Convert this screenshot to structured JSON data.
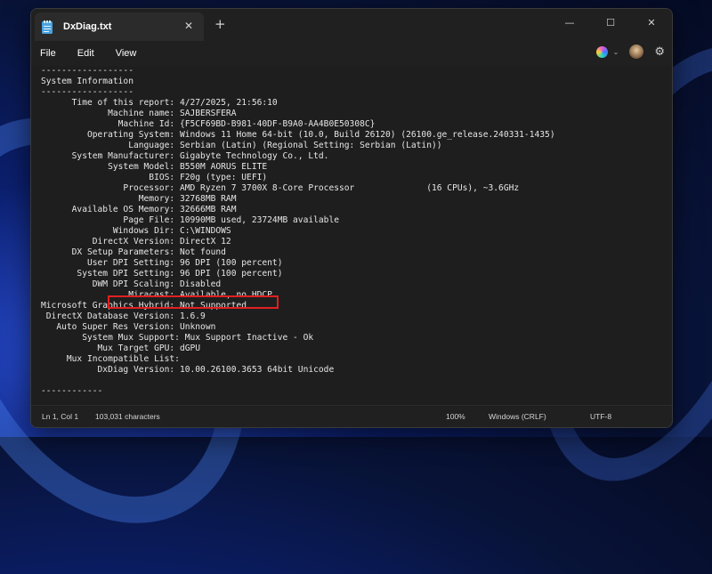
{
  "window": {
    "tab_title": "DxDiag.txt",
    "close_tab": "✕",
    "new_tab": "+",
    "minimize": "—",
    "maximize": "☐",
    "close": "✕"
  },
  "menu": {
    "file": "File",
    "edit": "Edit",
    "view": "View",
    "chevron": "⌄",
    "settings": "⚙"
  },
  "lines": [
    "------------------",
    "System Information",
    "------------------",
    "      Time of this report: 4/27/2025, 21:56:10",
    "             Machine name: SAJBERSFERA",
    "               Machine Id: {F5CF69BD-B981-40DF-B9A0-AA4B0E50308C}",
    "         Operating System: Windows 11 Home 64-bit (10.0, Build 26120) (26100.ge_release.240331-1435)",
    "                 Language: Serbian (Latin) (Regional Setting: Serbian (Latin))",
    "      System Manufacturer: Gigabyte Technology Co., Ltd.",
    "             System Model: B550M AORUS ELITE",
    "                     BIOS: F20g (type: UEFI)",
    "                Processor: AMD Ryzen 7 3700X 8-Core Processor              (16 CPUs), ~3.6GHz",
    "                   Memory: 32768MB RAM",
    "      Available OS Memory: 32666MB RAM",
    "                Page File: 10990MB used, 23724MB available",
    "              Windows Dir: C:\\WINDOWS",
    "          DirectX Version: DirectX 12",
    "      DX Setup Parameters: Not found",
    "         User DPI Setting: 96 DPI (100 percent)",
    "       System DPI Setting: 96 DPI (100 percent)",
    "          DWM DPI Scaling: Disabled",
    "                 Miracast: Available, no HDCP",
    "Microsoft Graphics Hybrid: Not Supported",
    " DirectX Database Version: 1.6.9",
    "   Auto Super Res Version: Unknown",
    "        System Mux Support: Mux Support Inactive - Ok",
    "           Mux Target GPU: dGPU",
    "     Mux Incompatible List:",
    "           DxDiag Version: 10.00.26100.3653 64bit Unicode",
    "",
    "------------"
  ],
  "status": {
    "position": "Ln 1, Col 1",
    "characters": "103,031 characters",
    "zoom": "100%",
    "line_ending": "Windows (CRLF)",
    "encoding": "UTF-8"
  }
}
